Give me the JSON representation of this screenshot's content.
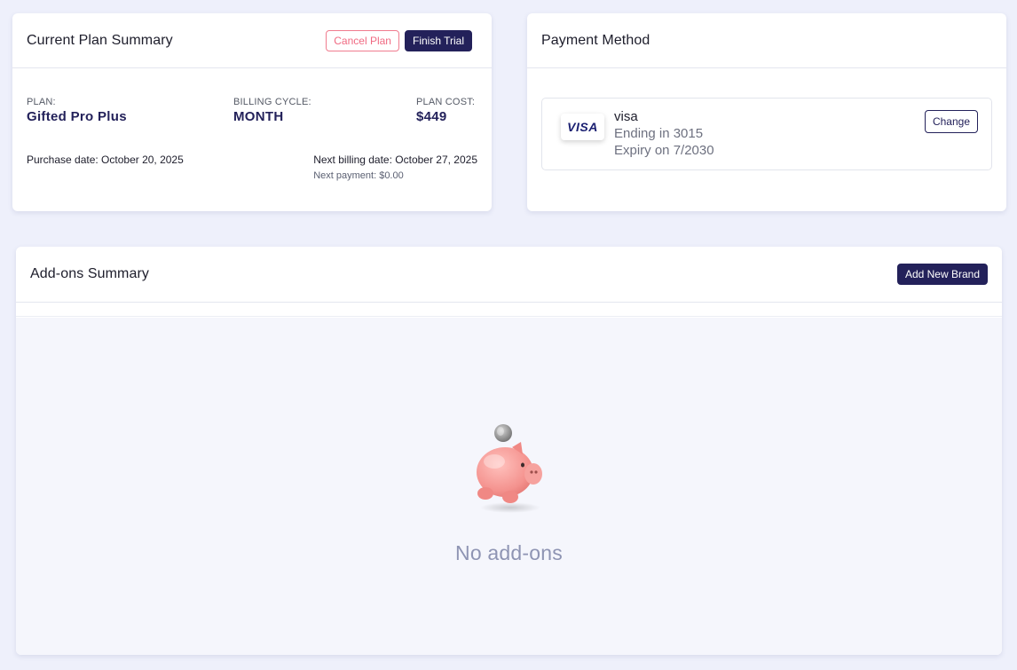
{
  "plan_card": {
    "title": "Current Plan Summary",
    "cancel_label": "Cancel Plan",
    "finish_label": "Finish Trial",
    "plan_label": "PLAN:",
    "plan_value": "Gifted Pro Plus",
    "cycle_label": "BILLING CYCLE:",
    "cycle_value": "MONTH",
    "cost_label": "PLAN COST:",
    "cost_value": "$449",
    "purchase_date": "Purchase date: October 20, 2025",
    "next_billing": "Next billing date: October 27, 2025",
    "next_payment": "Next payment: $0.00"
  },
  "payment_card": {
    "title": "Payment Method",
    "logo_text": "VISA",
    "brand": "visa",
    "ending": "Ending in 3015",
    "expiry": "Expiry on 7/2030",
    "change_label": "Change"
  },
  "addons_card": {
    "title": "Add-ons Summary",
    "add_label": "Add New Brand",
    "empty_text": "No add-ons",
    "empty_icon": "piggy-bank-icon"
  },
  "colors": {
    "background": "#eef0fb",
    "brand_dark": "#23215a",
    "cancel_red": "#f06a82",
    "empty_text": "#8e94b3",
    "pig_pink": "#f4928e"
  }
}
